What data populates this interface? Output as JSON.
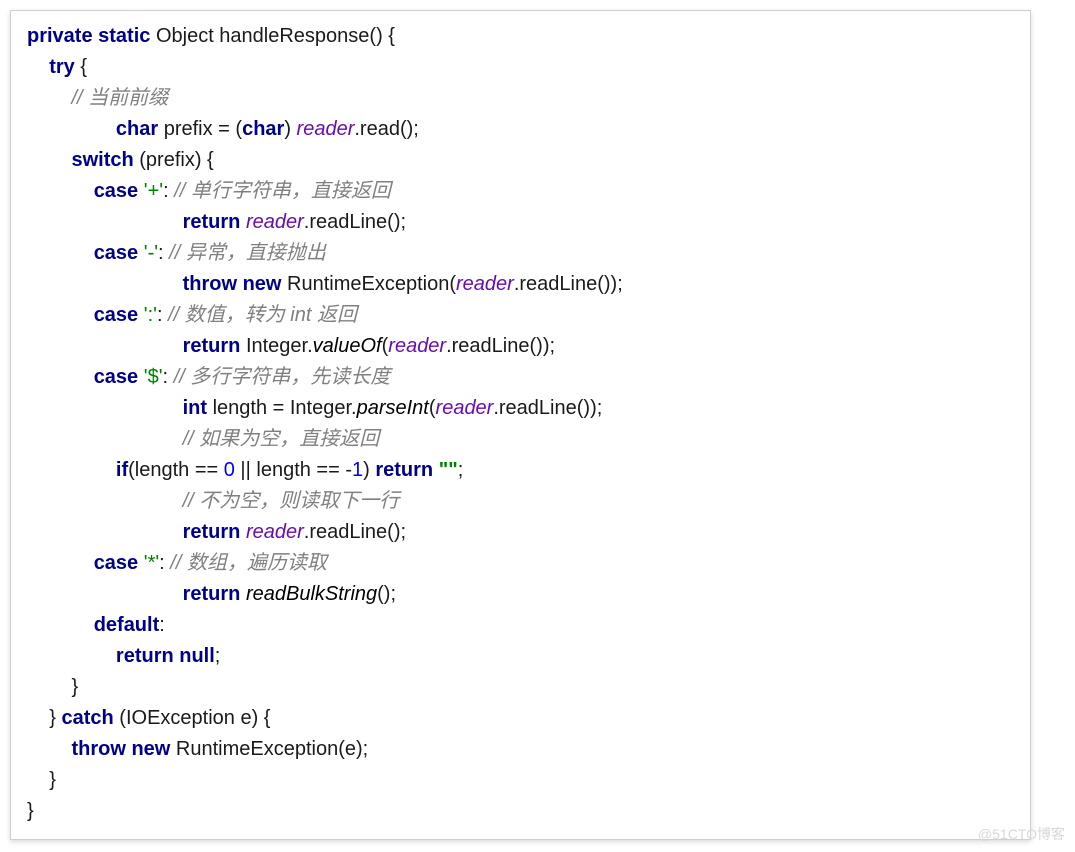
{
  "watermark": "@51CTO博客",
  "code": {
    "l1": {
      "a": "private static",
      "b": " Object handleResponse() {"
    },
    "l2": {
      "a": "try",
      "b": " {"
    },
    "l3": {
      "a": "// 当前前缀"
    },
    "l4": {
      "a": "char",
      "b": " prefix = (",
      "c": "char",
      "d": ") ",
      "e": "reader",
      "f": ".read();"
    },
    "l5": {
      "a": "switch",
      "b": " (prefix) {"
    },
    "l6": {
      "a": "case",
      "b": " ",
      "c": "'+'",
      "d": ": ",
      "e": "// 单行字符串，直接返回"
    },
    "l7": {
      "a": "return",
      "b": " ",
      "c": "reader",
      "d": ".readLine();"
    },
    "l8": {
      "a": "case",
      "b": " ",
      "c": "'-'",
      "d": ": ",
      "e": "// 异常，直接抛出"
    },
    "l9": {
      "a": "throw new",
      "b": " RuntimeException(",
      "c": "reader",
      "d": ".readLine());"
    },
    "l10": {
      "a": "case",
      "b": " ",
      "c": "':'",
      "d": ": ",
      "e": "// 数值，转为 int 返回"
    },
    "l11": {
      "a": "return",
      "b": " Integer.",
      "c": "valueOf",
      "d": "(",
      "e": "reader",
      "f": ".readLine());"
    },
    "l12": {
      "a": "case",
      "b": " ",
      "c": "'$'",
      "d": ": ",
      "e": "// 多行字符串，先读长度"
    },
    "l13": {
      "a": "int",
      "b": " length = Integer.",
      "c": "parseInt",
      "d": "(",
      "e": "reader",
      "f": ".readLine());"
    },
    "l14": {
      "a": "// 如果为空，直接返回"
    },
    "l15": {
      "a": "if",
      "b": "(length == ",
      "c": "0",
      "d": " || length == -",
      "e": "1",
      "f": ") ",
      "g": "return",
      "h": " ",
      "i": "\"\"",
      "j": ";"
    },
    "l16": {
      "a": "// 不为空，则读取下一行"
    },
    "l17": {
      "a": "return",
      "b": " ",
      "c": "reader",
      "d": ".readLine();"
    },
    "l18": {
      "a": "case",
      "b": " ",
      "c": "'*'",
      "d": ": ",
      "e": "// 数组，遍历读取"
    },
    "l19": {
      "a": "return",
      "b": " ",
      "c": "readBulkString",
      "d": "();"
    },
    "l20": {
      "a": "default",
      "b": ":"
    },
    "l21": {
      "a": "return null",
      "b": ";"
    },
    "l22": {
      "a": "}"
    },
    "l23": {
      "a": "} ",
      "b": "catch",
      "c": " (IOException e) {"
    },
    "l24": {
      "a": "throw new",
      "b": " RuntimeException(e);"
    },
    "l25": {
      "a": "}"
    },
    "l26": {
      "a": "}"
    }
  }
}
